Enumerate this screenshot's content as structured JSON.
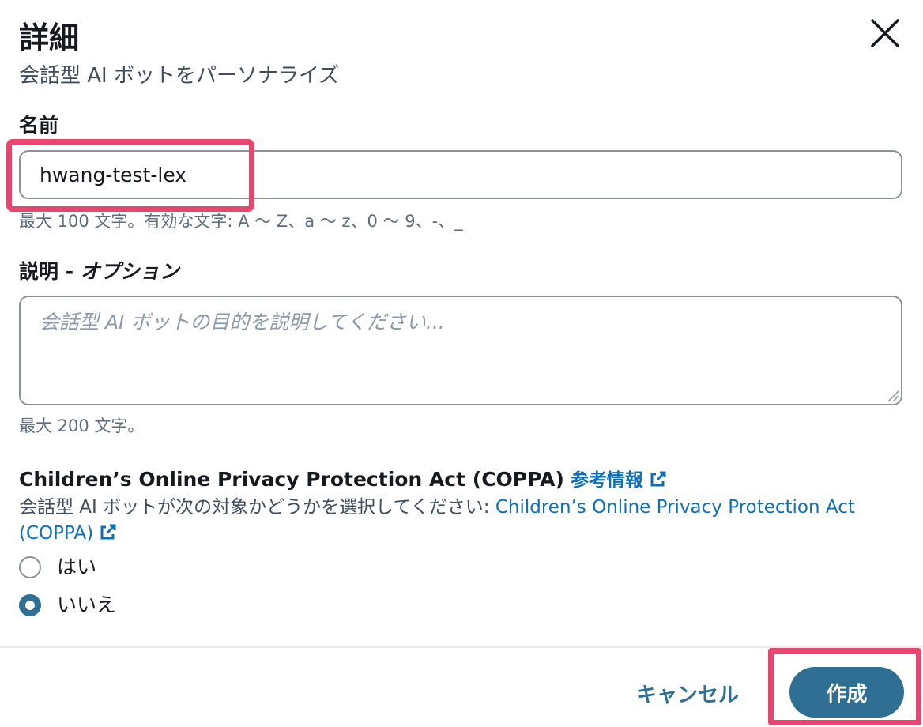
{
  "header": {
    "title": "詳細",
    "subtitle": "会話型 AI ボットをパーソナライズ"
  },
  "close": {
    "icon": "close-icon"
  },
  "name_field": {
    "label": "名前",
    "value": "hwang-test-lex",
    "constraint": "最大 100 文字。有効な文字: A ～ Z、a ～ z、0 ～ 9、-、_"
  },
  "description_field": {
    "label": "説明",
    "label_optional": "オプション",
    "label_separator": " - ",
    "placeholder": "会話型 AI ボットの目的を説明してください...",
    "value": "",
    "constraint": "最大 200 文字。"
  },
  "coppa": {
    "heading": "Children’s Online Privacy Protection Act (COPPA)",
    "info_link": "参考情報",
    "description": "会話型 AI ボットが次の対象かどうかを選択してください: ",
    "link_text": "Children’s Online Privacy Protection Act (COPPA)",
    "options": [
      {
        "label": "はい",
        "selected": false
      },
      {
        "label": "いいえ",
        "selected": true
      }
    ]
  },
  "footer": {
    "cancel_label": "キャンセル",
    "create_label": "作成"
  },
  "colors": {
    "primary": "#2e6f93",
    "link": "#0f6fb5",
    "highlight": "#e8456f",
    "border": "#8c9196"
  }
}
